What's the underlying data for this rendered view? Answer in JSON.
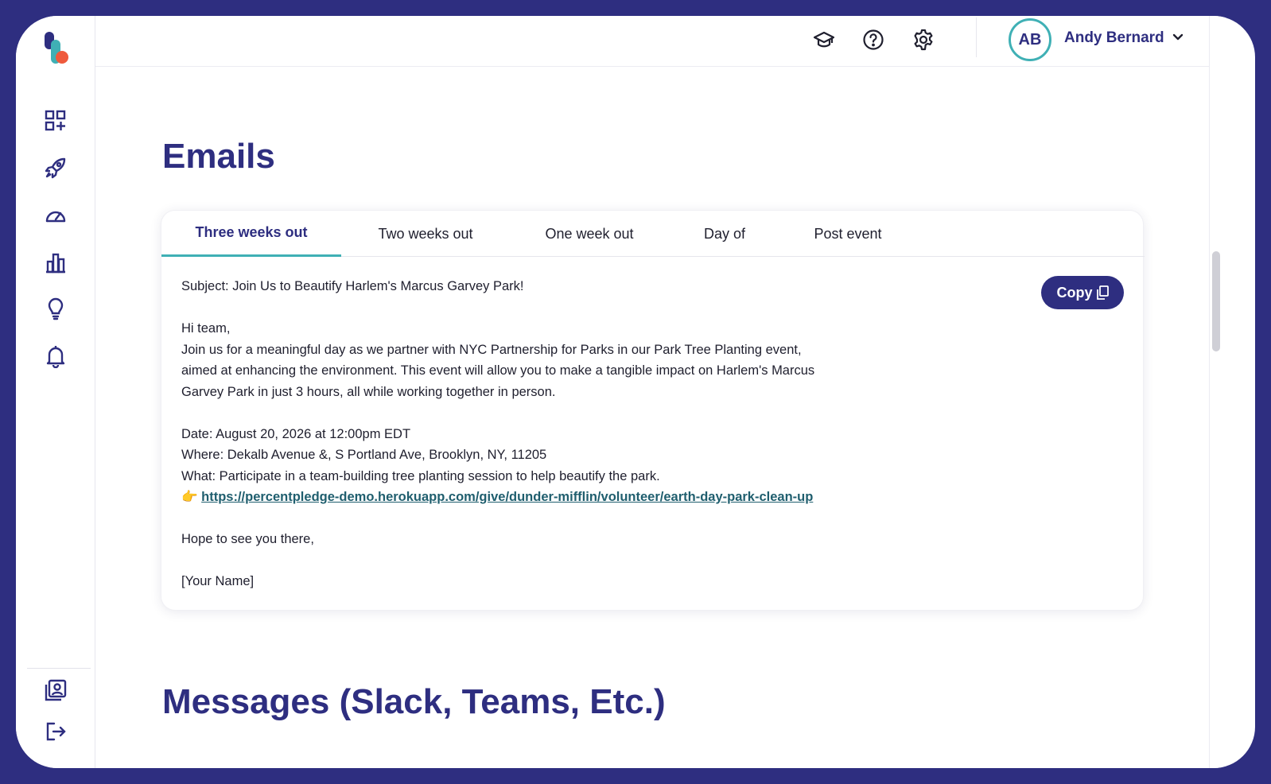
{
  "user": {
    "initials": "AB",
    "name": "Andy Bernard"
  },
  "page": {
    "title": "Emails",
    "next_section_title": "Messages (Slack, Teams, Etc.)"
  },
  "tabs": [
    {
      "label": "Three weeks out",
      "active": true
    },
    {
      "label": "Two weeks out",
      "active": false
    },
    {
      "label": "One week out",
      "active": false
    },
    {
      "label": "Day of",
      "active": false
    },
    {
      "label": "Post event",
      "active": false
    }
  ],
  "copy_button": {
    "label": "Copy"
  },
  "email": {
    "subject": "Subject: Join Us to Beautify Harlem's Marcus Garvey Park!",
    "greeting": "Hi team,",
    "body_1": "Join us for a meaningful day as we partner with NYC Partnership for Parks in our Park Tree Planting event,",
    "body_2": "aimed at enhancing the environment. This event will allow you to make a tangible impact on Harlem's Marcus",
    "body_3": "Garvey Park in just 3 hours, all while working together in person.",
    "date": "Date: August 20, 2026 at 12:00pm EDT",
    "where": "Where: Dekalb Avenue &, S Portland Ave, Brooklyn, NY, 11205",
    "what": "What: Participate in a team-building tree planting session to help beautify the park.",
    "link_emoji": "👉",
    "link": "https://percentpledge-demo.herokuapp.com/give/dunder-mifflin/volunteer/earth-day-park-clean-up",
    "closing": "Hope to see you there,",
    "signature": "[Your Name]"
  },
  "colors": {
    "brand": "#2e2e80",
    "accent": "#3fb0b5",
    "link": "#1f5e6e"
  },
  "icons": {
    "sidebar": [
      "dashboard-add-icon",
      "rocket-icon",
      "speedometer-icon",
      "bar-chart-icon",
      "lightbulb-icon",
      "bell-icon",
      "profile-card-icon",
      "logout-icon"
    ],
    "topbar": [
      "graduation-cap-icon",
      "help-icon",
      "gear-icon",
      "chevron-down-icon"
    ]
  }
}
